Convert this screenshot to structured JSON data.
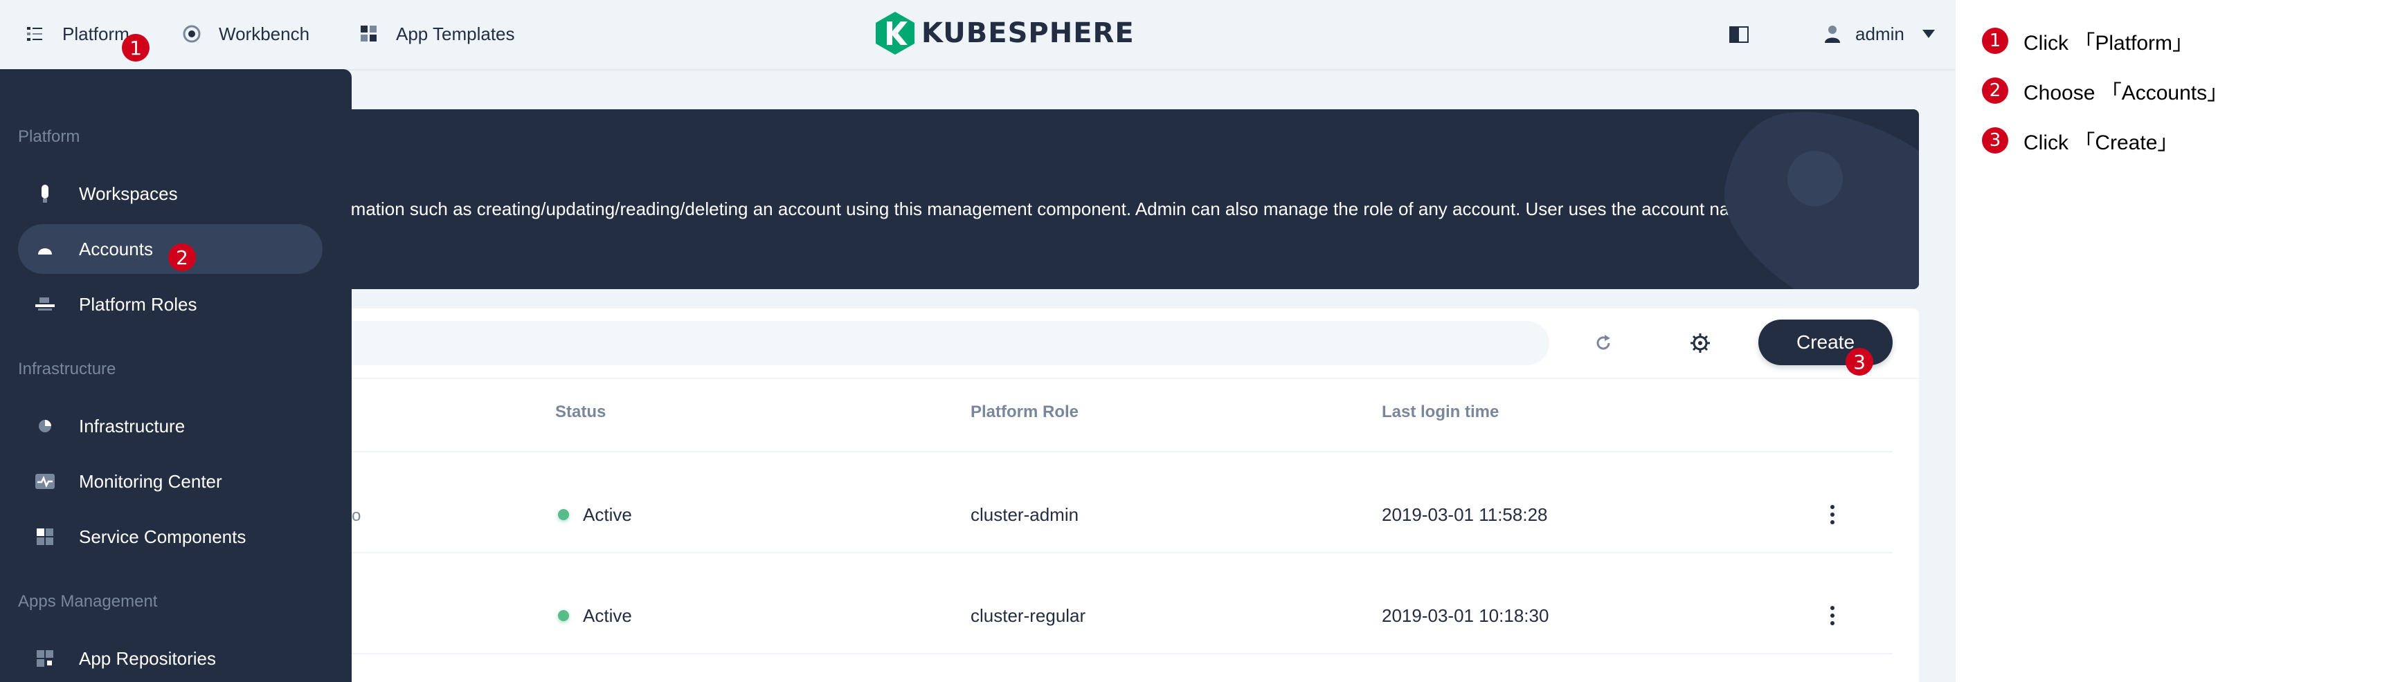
{
  "topbar": {
    "platform_label": "Platform",
    "workbench_label": "Workbench",
    "app_templates_label": "App Templates",
    "logo_text": "KUBESPHERE",
    "user_name": "admin"
  },
  "banner": {
    "description": "rmation such as creating/updating/reading/deleting an account using this management component. Admin can also manage the role of any account. User uses the account name or email to log"
  },
  "toolbar": {
    "create_label": "Create"
  },
  "table": {
    "headers": [
      "Status",
      "Platform Role",
      "Last login time"
    ],
    "rows": [
      {
        "partial": "o",
        "status": "Active",
        "role": "cluster-admin",
        "last_login": "2019-03-01 11:58:28"
      },
      {
        "partial": "",
        "status": "Active",
        "role": "cluster-regular",
        "last_login": "2019-03-01 10:18:30"
      }
    ]
  },
  "sidemenu": {
    "groups": [
      {
        "title": "Platform",
        "items": [
          "Workspaces",
          "Accounts",
          "Platform Roles"
        ]
      },
      {
        "title": "Infrastructure",
        "items": [
          "Infrastructure",
          "Monitoring Center",
          "Service Components"
        ]
      },
      {
        "title": "Apps Management",
        "items": [
          "App Repositories"
        ]
      }
    ],
    "active_item": "Accounts"
  },
  "markers": [
    "1",
    "2",
    "3"
  ],
  "guide": {
    "steps": [
      {
        "num": "1",
        "text": "Click 「Platform」"
      },
      {
        "num": "2",
        "text": "Choose 「Accounts」"
      },
      {
        "num": "3",
        "text": "Click 「Create」"
      }
    ]
  },
  "colors": {
    "dark": "#242e42",
    "accent_green": "#55bc8a",
    "marker_red": "#d0021b",
    "logo_green": "#00a971"
  }
}
